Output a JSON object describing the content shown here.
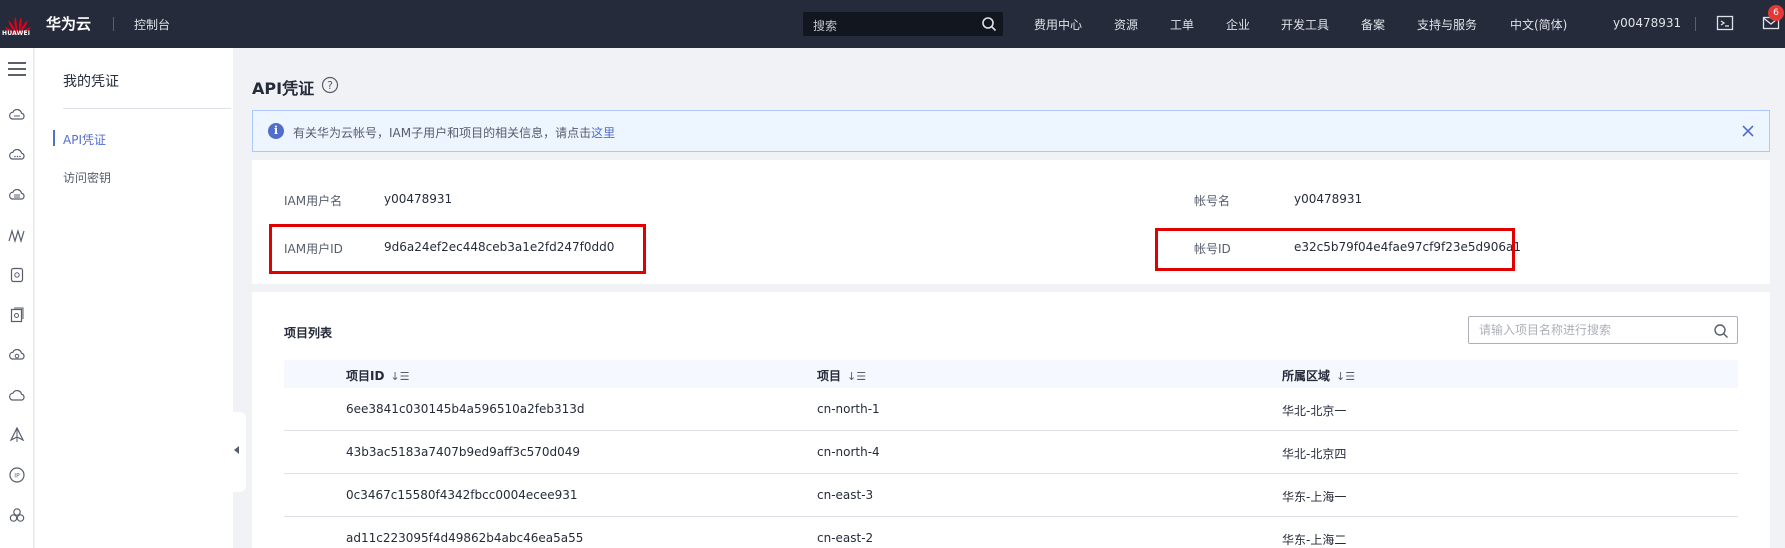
{
  "topbar": {
    "logo_text": "HUAWEI",
    "brand": "华为云",
    "console": "控制台",
    "search_placeholder": "搜索",
    "nav": [
      "费用中心",
      "资源",
      "工单",
      "企业",
      "开发工具",
      "备案",
      "支持与服务",
      "中文(简体)",
      "y00478931"
    ],
    "mail_badge": "6"
  },
  "sidebar": {
    "title": "我的凭证",
    "items": [
      {
        "label": "API凭证",
        "active": true
      },
      {
        "label": "访问密钥",
        "active": false
      }
    ]
  },
  "page": {
    "title": "API凭证"
  },
  "notice": {
    "text": "有关华为云帐号，IAM子用户和项目的相关信息，请点击",
    "link": "这里"
  },
  "credentials": {
    "iam_user_name_label": "IAM用户名",
    "iam_user_name": "y00478931",
    "account_name_label": "帐号名",
    "account_name": "y00478931",
    "iam_user_id_label": "IAM用户ID",
    "iam_user_id": "9d6a24ef2ec448ceb3a1e2fd247f0dd0",
    "account_id_label": "帐号ID",
    "account_id": "e32c5b79f04e4fae97cf9f23e5d906a1"
  },
  "projects": {
    "title": "项目列表",
    "search_placeholder": "请输入项目名称进行搜索",
    "columns": [
      "项目ID",
      "项目",
      "所属区域"
    ],
    "sort_glyph": "↓☰",
    "rows": [
      [
        "6ee3841c030145b4a596510a2feb313d",
        "cn-north-1",
        "华北-北京一"
      ],
      [
        "43b3ac5183a7407b9ed9aff3c570d049",
        "cn-north-4",
        "华北-北京四"
      ],
      [
        "0c3467c15580f4342fbcc0004ecee931",
        "cn-east-3",
        "华东-上海一"
      ],
      [
        "ad11c223095f4d49862b4abc46ea5a55",
        "cn-east-2",
        "华东-上海二"
      ]
    ]
  },
  "colors": {
    "topbar_bg": "#252b3a",
    "accent": "#526ecc",
    "highlight_box": "#e00000",
    "badge": "#e53935"
  }
}
